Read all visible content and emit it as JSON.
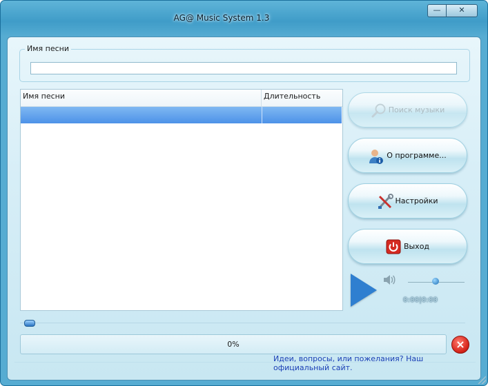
{
  "window": {
    "title": "AG@ Music System 1.3",
    "minimize_glyph": "—",
    "close_glyph": "✕"
  },
  "search": {
    "group_label": "Имя песни",
    "value": "",
    "placeholder": ""
  },
  "list": {
    "columns": [
      "Имя песни",
      "Длительность"
    ],
    "rows": [
      {
        "name": "",
        "duration": ""
      }
    ]
  },
  "buttons": {
    "search_music": {
      "label": "Поиск музыки",
      "icon": "magnifier-icon",
      "enabled": false
    },
    "about": {
      "label": "О программе...",
      "icon": "user-info-icon",
      "enabled": true
    },
    "settings": {
      "label": "Настройки",
      "icon": "tools-icon",
      "enabled": true
    },
    "exit": {
      "label": "Выход",
      "icon": "power-icon",
      "enabled": true
    }
  },
  "player": {
    "time": "0:00|0:00",
    "volume": 0.45,
    "seek": 0.0
  },
  "progress": {
    "label": "0%",
    "value": 0
  },
  "footer": {
    "link_text": "Идеи, вопросы, или пожелания? Наш официальный сайт."
  },
  "colors": {
    "frame": "#56acd2",
    "selection": "#4d92e8",
    "link": "#1a3fb5",
    "cancel": "#d7261c"
  }
}
